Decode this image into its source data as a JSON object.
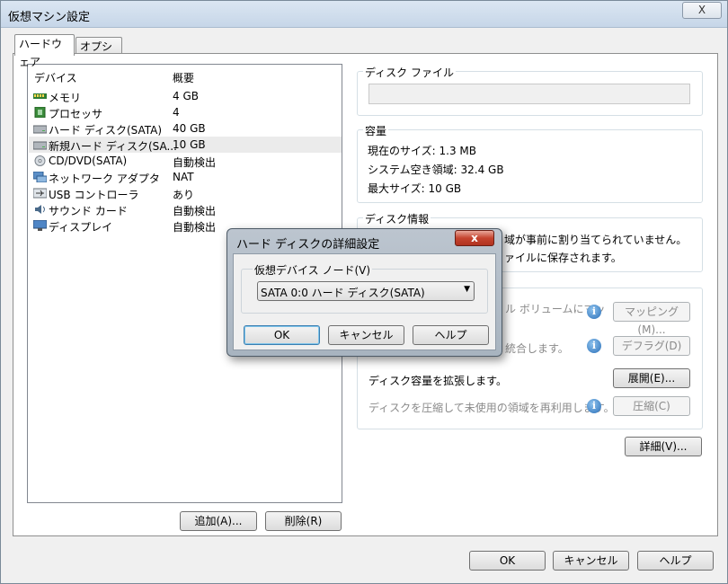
{
  "window": {
    "title": "仮想マシン設定",
    "close_label": "X"
  },
  "tabs": [
    {
      "label": "ハードウェア"
    },
    {
      "label": "オプション"
    }
  ],
  "device_list": {
    "headers": {
      "device": "デバイス",
      "summary": "概要"
    },
    "rows": [
      {
        "name": "メモリ",
        "summary": "4 GB",
        "icon": "memory-icon"
      },
      {
        "name": "プロセッサ",
        "summary": "4",
        "icon": "processor-icon"
      },
      {
        "name": "ハード ディスク(SATA)",
        "summary": "40 GB",
        "icon": "hard-disk-icon"
      },
      {
        "name": "新規ハード ディスク(SA...",
        "summary": "10 GB",
        "icon": "hard-disk-icon"
      },
      {
        "name": "CD/DVD(SATA)",
        "summary": "自動検出",
        "icon": "cd-dvd-icon"
      },
      {
        "name": "ネットワーク アダプタ",
        "summary": "NAT",
        "icon": "network-adapter-icon"
      },
      {
        "name": "USB コントローラ",
        "summary": "あり",
        "icon": "usb-icon"
      },
      {
        "name": "サウンド カード",
        "summary": "自動検出",
        "icon": "sound-icon"
      },
      {
        "name": "ディスプレイ",
        "summary": "自動検出",
        "icon": "display-icon"
      }
    ],
    "selected_index": 3
  },
  "buttons": {
    "add": "追加(A)...",
    "remove": "削除(R)",
    "details": "詳細(V)...",
    "ok": "OK",
    "cancel": "キャンセル",
    "help": "ヘルプ"
  },
  "disk_file": {
    "title": "ディスク ファイル",
    "value": ""
  },
  "capacity": {
    "title": "容量",
    "current_size": "現在のサイズ: 1.3 MB",
    "free_space": "システム空き領域: 32.4 GB",
    "max_size": "最大サイズ: 10 GB"
  },
  "disk_info": {
    "title": "ディスク情報",
    "line1": "域が事前に割り当てられていません。",
    "line2": "ァイルに保存されます。"
  },
  "utilities": {
    "map_text": "ル ボリュームにマッ",
    "map_button": "マッピング(M)...",
    "defrag_text": "統合します。",
    "defrag_button": "デフラグ(D)",
    "expand_text": "ディスク容量を拡張します。",
    "expand_button": "展開(E)...",
    "compact_text": "ディスクを圧縮して未使用の領域を再利用します。",
    "compact_button": "圧縮(C)"
  },
  "dialog": {
    "title": "ハード ディスクの詳細設定",
    "close_label": "x",
    "group_label": "仮想デバイス ノード(V)",
    "selected_node": "SATA 0:0   ハード ディスク(SATA)",
    "ok": "OK",
    "cancel": "キャンセル",
    "help": "ヘルプ"
  }
}
